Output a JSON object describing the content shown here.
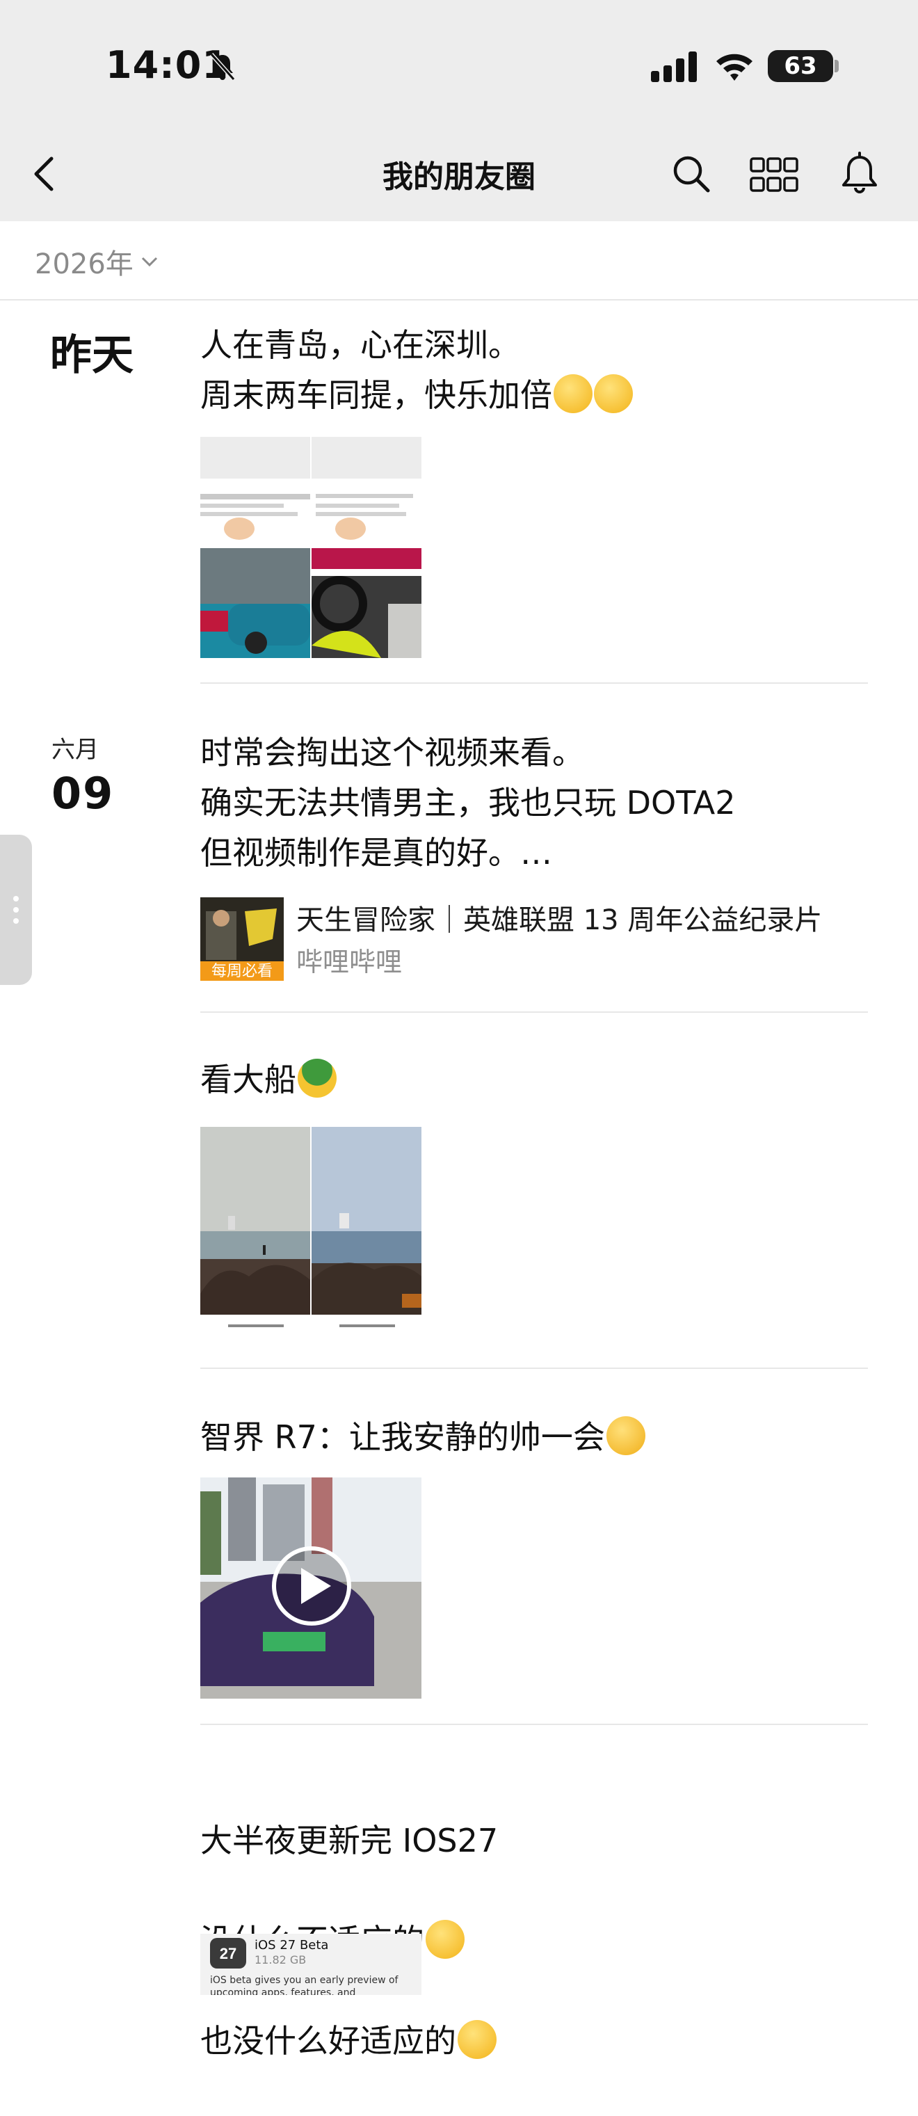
{
  "status_bar": {
    "time": "14:01",
    "battery": "63",
    "battery_level": 0.63
  },
  "nav": {
    "title": "我的朋友圈"
  },
  "filter": {
    "year": "2026年"
  },
  "posts": [
    {
      "date_label": "昨天",
      "text": "人在青岛，心在深圳。\n周末两车同提，快乐加倍",
      "emoji": [
        "grin-emoji",
        "grin-emoji"
      ],
      "images": [
        "car-interior-thumb",
        "car-lot-thumb"
      ]
    },
    {
      "date_month": "六月",
      "date_day": "09",
      "text": "时常会掏出这个视频来看。\n确实无法共情男主，我也只玩 DOTA2\n但视频制作是真的好。…",
      "share": {
        "title": "天生冒险家｜英雄联盟 13 周年公益纪录片",
        "source": "哔哩哔哩",
        "badge": "每周必看"
      }
    },
    {
      "text": "看大船",
      "emoji": [
        "helmet-emoji"
      ],
      "images": [
        "sea-rocks-thumb",
        "sea-ship-thumb"
      ]
    },
    {
      "text": "智界 R7：让我安静的帅一会",
      "emoji": [
        "thinking-emoji"
      ],
      "video": "purple-car-video"
    },
    {
      "text_lines": [
        "大半夜更新完 IOS27",
        "没什么不适应的",
        "也没什么好适应的"
      ],
      "card": {
        "title": "iOS 27 Beta",
        "size": "11.82 GB",
        "desc": "iOS beta gives you an early preview of upcoming apps, features, and technologies."
      }
    }
  ],
  "colors": {
    "nav_bg": "#ededed",
    "divider": "#e7e7e7",
    "muted": "#8a8a8a"
  }
}
